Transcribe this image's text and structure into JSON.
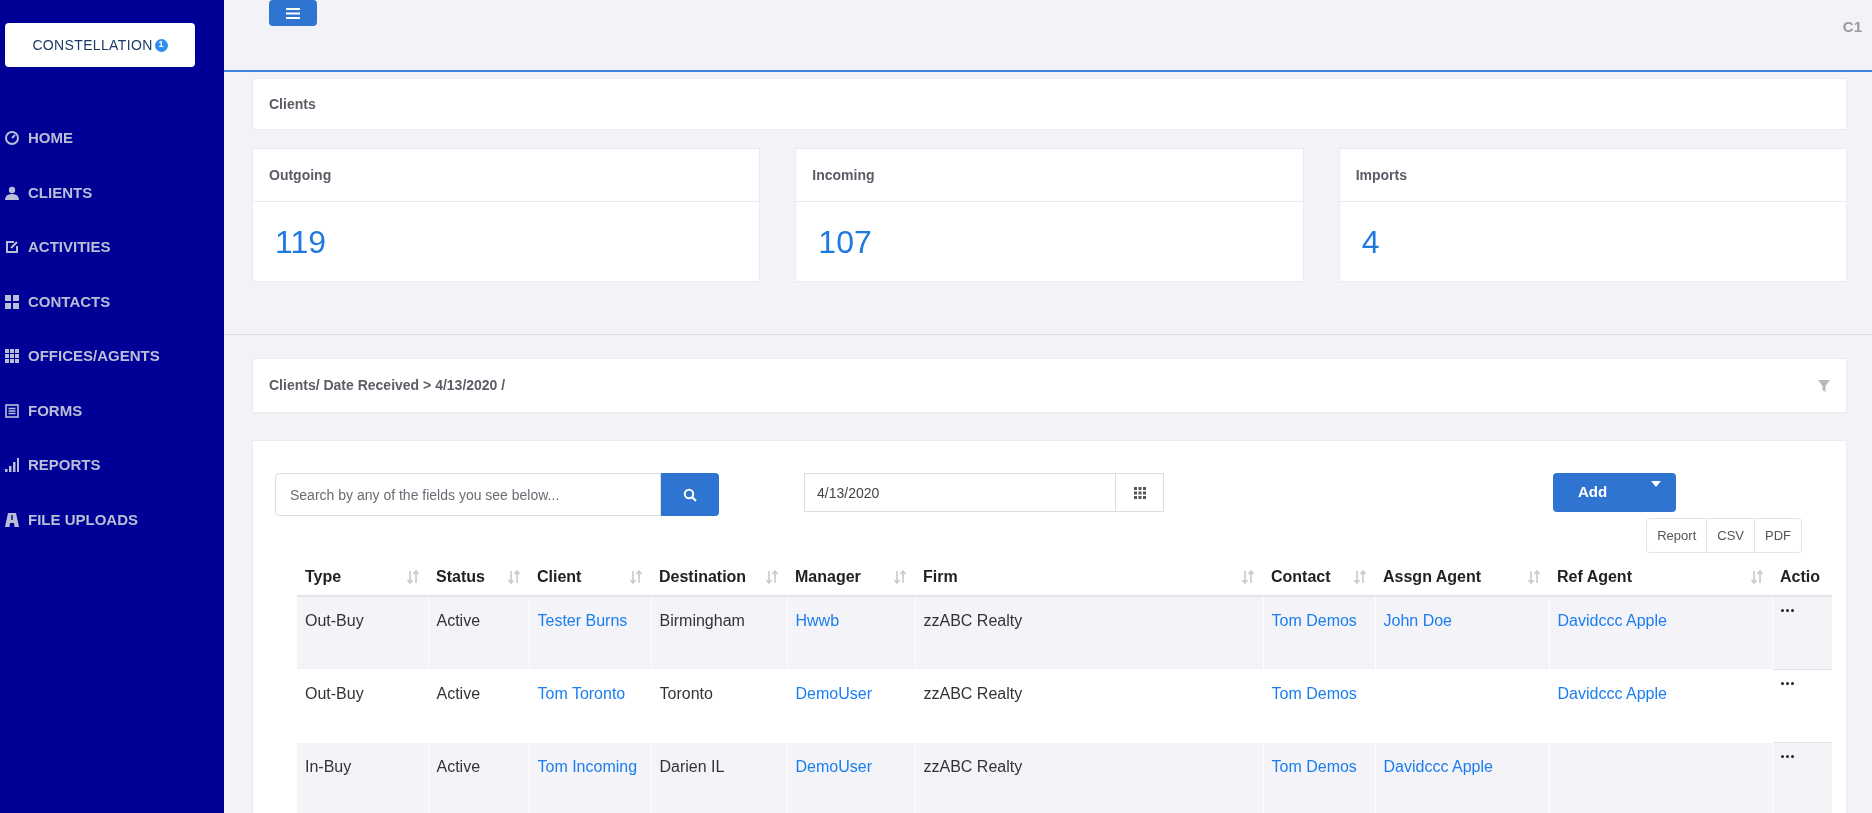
{
  "logo": {
    "text": "CONSTELLATION",
    "badge": "1"
  },
  "header": {
    "user": "C1"
  },
  "sidebar": {
    "items": [
      {
        "label": "HOME",
        "kind": "dashboard"
      },
      {
        "label": "CLIENTS",
        "kind": "user"
      },
      {
        "label": "ACTIVITIES",
        "kind": "edit"
      },
      {
        "label": "CONTACTS",
        "kind": "grid4"
      },
      {
        "label": "OFFICES/AGENTS",
        "kind": "grid9"
      },
      {
        "label": "FORMS",
        "kind": "list"
      },
      {
        "label": "REPORTS",
        "kind": "bars"
      },
      {
        "label": "FILE UPLOADS",
        "kind": "road"
      }
    ]
  },
  "breadcrumb": "Clients",
  "stats": [
    {
      "label": "Outgoing",
      "value": "119"
    },
    {
      "label": "Incoming",
      "value": "107"
    },
    {
      "label": "Imports",
      "value": "4"
    }
  ],
  "filter_bar": {
    "path": "Clients/ Date Received > 4/13/2020 /"
  },
  "toolbar": {
    "search": {
      "placeholder": "Search by any of the fields you see below..."
    },
    "date": {
      "value": "4/13/2020"
    },
    "add_button": "Add",
    "exports": [
      "Report",
      "CSV",
      "PDF"
    ]
  },
  "table": {
    "columns": [
      {
        "label": "Type",
        "sortable": true
      },
      {
        "label": "Status",
        "sortable": true
      },
      {
        "label": "Client",
        "sortable": true
      },
      {
        "label": "Destination",
        "sortable": true
      },
      {
        "label": "Manager",
        "sortable": true
      },
      {
        "label": "Firm",
        "sortable": true
      },
      {
        "label": "Contact",
        "sortable": true
      },
      {
        "label": "Assgn Agent",
        "sortable": true
      },
      {
        "label": "Ref Agent",
        "sortable": true
      },
      {
        "label": "Actio"
      }
    ],
    "rows": [
      {
        "cells": [
          {
            "text": "Out-Buy",
            "link": false
          },
          {
            "text": "Active",
            "link": false
          },
          {
            "text": "Tester Burns",
            "link": true
          },
          {
            "text": "Birmingham",
            "link": false
          },
          {
            "text": "Hwwb",
            "link": true
          },
          {
            "text": "zzABC Realty",
            "link": false
          },
          {
            "text": "Tom Demos",
            "link": true
          },
          {
            "text": "John Doe",
            "link": true
          },
          {
            "text": "Davidccc Apple",
            "link": true
          }
        ]
      },
      {
        "cells": [
          {
            "text": "Out-Buy",
            "link": false
          },
          {
            "text": "Active",
            "link": false
          },
          {
            "text": "Tom Toronto",
            "link": true
          },
          {
            "text": "Toronto",
            "link": false
          },
          {
            "text": "DemoUser",
            "link": true
          },
          {
            "text": "zzABC Realty",
            "link": false
          },
          {
            "text": "Tom Demos",
            "link": true
          },
          null,
          {
            "text": "Davidccc Apple",
            "link": true
          }
        ]
      },
      {
        "cells": [
          {
            "text": "In-Buy",
            "link": false
          },
          {
            "text": "Active",
            "link": false
          },
          {
            "text": "Tom Incoming",
            "link": true
          },
          {
            "text": "Darien IL",
            "link": false
          },
          {
            "text": "DemoUser",
            "link": true
          },
          {
            "text": "zzABC Realty",
            "link": false
          },
          {
            "text": "Tom Demos",
            "link": true
          },
          {
            "text": "Davidccc Apple",
            "link": true
          },
          null
        ]
      }
    ]
  }
}
